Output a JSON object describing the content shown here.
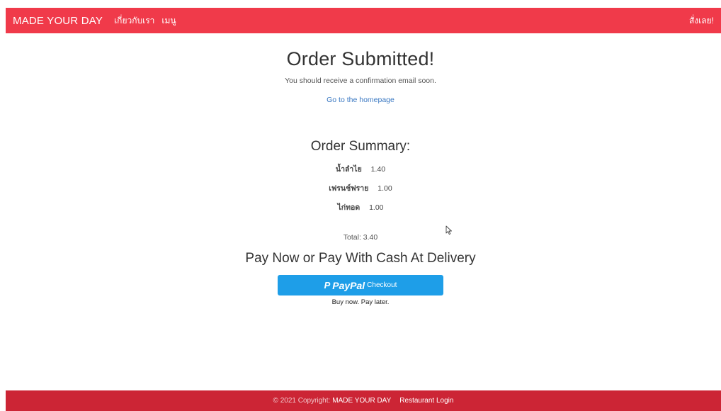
{
  "navbar": {
    "brand": "MADE YOUR DAY",
    "links": [
      "เกี่ยวกับเรา",
      "เมนู"
    ],
    "order_now": "สั่งเลย!"
  },
  "confirmation": {
    "title": "Order Submitted!",
    "message": "You should receive a confirmation email soon.",
    "home_link": "Go to the homepage"
  },
  "summary": {
    "title": "Order Summary:",
    "items": [
      {
        "name": "น้ำลำไย",
        "price": "1.40"
      },
      {
        "name": "เฟรนช์ฟราย",
        "price": "1.00"
      },
      {
        "name": "ไก่ทอด",
        "price": "1.00"
      }
    ],
    "total": "Total: 3.40"
  },
  "payment": {
    "heading": "Pay Now or Pay With Cash At Delivery",
    "paypal_icon": "P",
    "paypal_brand": "PayPal",
    "paypal_checkout": "Checkout",
    "tagline": "Buy now. Pay later.",
    "button_color": "#1e9ee8"
  },
  "footer": {
    "copyright": "© 2021 Copyright:",
    "brand": "MADE YOUR DAY",
    "login": "Restaurant Login"
  },
  "colors": {
    "navbar": "#f03a4a",
    "footer": "#cc2535"
  }
}
